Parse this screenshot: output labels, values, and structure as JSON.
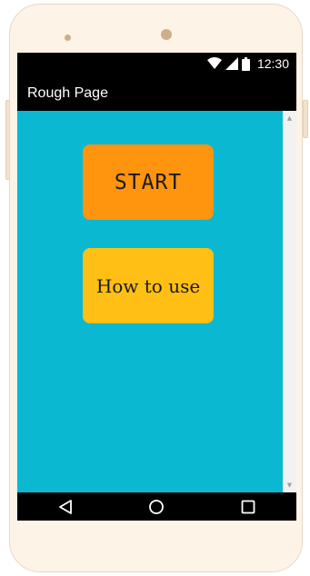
{
  "status_bar": {
    "time": "12:30",
    "icons": [
      "wifi-icon",
      "signal-icon",
      "battery-icon"
    ]
  },
  "app_bar": {
    "title": "Rough Page"
  },
  "main": {
    "start_button_label": "START",
    "how_to_use_button_label": "How to use"
  },
  "navigation": {
    "icons": [
      "back-icon",
      "home-icon",
      "recents-icon"
    ]
  },
  "colors": {
    "content_background": "#0ab8d2",
    "start_button": "#ff940e",
    "how_to_use_button": "#ffbf14",
    "bars": "#000000",
    "device_body": "#fdf3e7"
  }
}
